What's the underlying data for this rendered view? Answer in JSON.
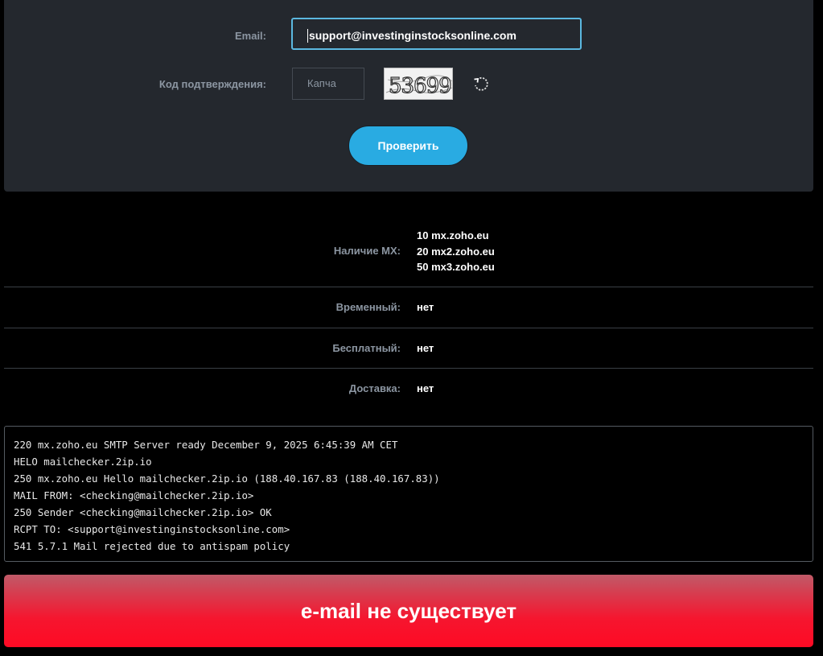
{
  "form": {
    "email_label": "Email:",
    "email_value": "support@investinginstocksonline.com",
    "code_label": "Код подтверждения:",
    "captcha_placeholder": "Капча",
    "captcha_text": "53699",
    "verify_label": "Проверить"
  },
  "results": {
    "mx_label": "Наличие MX:",
    "mx_records": [
      {
        "priority": "10",
        "host": "mx.zoho.eu"
      },
      {
        "priority": "20",
        "host": "mx2.zoho.eu"
      },
      {
        "priority": "50",
        "host": "mx3.zoho.eu"
      }
    ],
    "temporary_label": "Временный:",
    "temporary_value": "нет",
    "free_label": "Бесплатный:",
    "free_value": "нет",
    "delivery_label": "Доставка:",
    "delivery_value": "нет"
  },
  "log": [
    "220 mx.zoho.eu SMTP Server ready December 9, 2025 6:45:39 AM CET",
    "HELO mailchecker.2ip.io",
    "250 mx.zoho.eu Hello mailchecker.2ip.io (188.40.167.83 (188.40.167.83))",
    "MAIL FROM: <checking@mailchecker.2ip.io>",
    "250 Sender <checking@mailchecker.2ip.io> OK",
    "RCPT TO: <support@investinginstocksonline.com>",
    "541 5.7.1 Mail rejected due to antispam policy"
  ],
  "verdict": "e-mail не существует",
  "colors": {
    "accent": "#29abe2",
    "panel": "#24282e",
    "error": "#f5162f"
  }
}
